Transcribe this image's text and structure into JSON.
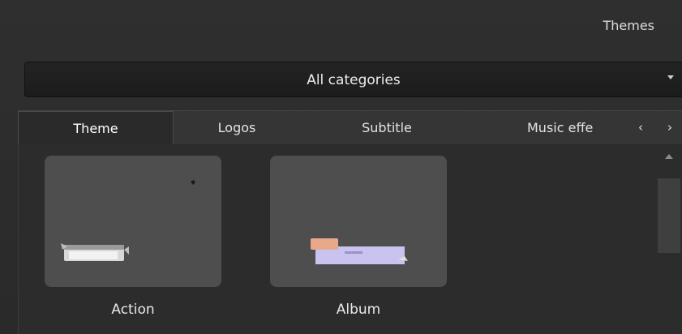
{
  "panel": {
    "title": "Themes"
  },
  "category_select": {
    "selected": "All categories"
  },
  "tabs": [
    {
      "label": "Theme",
      "active": true
    },
    {
      "label": "Logos",
      "active": false
    },
    {
      "label": "Subtitle",
      "active": false
    },
    {
      "label": "Music effe",
      "active": false
    }
  ],
  "tab_scroll": {
    "prev_icon": "chevron-left-icon",
    "next_icon": "chevron-right-icon"
  },
  "themes": [
    {
      "label": "Action"
    },
    {
      "label": "Album"
    }
  ],
  "colors": {
    "background": "#2c2c2c",
    "thumbnail": "#4e4e4e",
    "album_card": "#c9c3ef",
    "album_tape": "#e8a88a"
  }
}
